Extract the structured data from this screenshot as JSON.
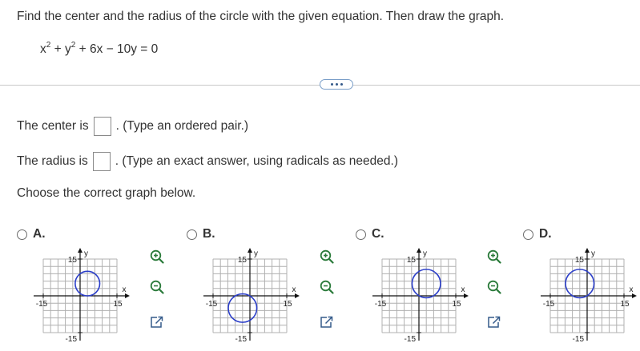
{
  "question": {
    "prompt": "Find the center and the radius of the circle with the given equation. Then draw the graph.",
    "equation": {
      "x_term": "x",
      "x_exp": "2",
      "plus_y": " + y",
      "y_exp": "2",
      "rest": " + 6x − 10y = 0"
    }
  },
  "answers": {
    "center_prefix": "The center is",
    "center_suffix": ". (Type an ordered pair.)",
    "center_value": "",
    "radius_prefix": "The radius is",
    "radius_suffix": ". (Type an exact answer, using radicals as needed.)",
    "radius_value": ""
  },
  "choose_text": "Choose the correct graph below.",
  "options": [
    {
      "label": "A.",
      "chart_data": {
        "type": "scatter",
        "shape": "circle",
        "xlim": [
          -15,
          15
        ],
        "ylim": [
          -15,
          15
        ],
        "xlabel": "x",
        "ylabel": "y",
        "x_tick_labels": [
          "-15",
          "15"
        ],
        "y_tick_labels": [
          "15",
          "-15"
        ],
        "center": [
          3,
          5
        ],
        "radius": 5,
        "grid": true,
        "circle_color": "#2b3ec9"
      }
    },
    {
      "label": "B.",
      "chart_data": {
        "type": "scatter",
        "shape": "circle",
        "xlim": [
          -15,
          15
        ],
        "ylim": [
          -15,
          15
        ],
        "xlabel": "x",
        "ylabel": "y",
        "x_tick_labels": [
          "-15",
          "15"
        ],
        "y_tick_labels": [
          "15",
          "-15"
        ],
        "center": [
          -3,
          -5
        ],
        "radius": 5.8,
        "grid": true,
        "circle_color": "#2b3ec9"
      }
    },
    {
      "label": "C.",
      "chart_data": {
        "type": "scatter",
        "shape": "circle",
        "xlim": [
          -15,
          15
        ],
        "ylim": [
          -15,
          15
        ],
        "xlabel": "x",
        "ylabel": "y",
        "x_tick_labels": [
          "-15",
          "15"
        ],
        "y_tick_labels": [
          "15",
          "-15"
        ],
        "center": [
          3,
          5
        ],
        "radius": 5.8,
        "grid": true,
        "circle_color": "#2b3ec9"
      }
    },
    {
      "label": "D.",
      "chart_data": {
        "type": "scatter",
        "shape": "circle",
        "xlim": [
          -15,
          15
        ],
        "ylim": [
          -15,
          15
        ],
        "xlabel": "x",
        "ylabel": "y",
        "x_tick_labels": [
          "-15",
          "15"
        ],
        "y_tick_labels": [
          "15",
          "-15"
        ],
        "center": [
          -3,
          5
        ],
        "radius": 5.8,
        "grid": true,
        "circle_color": "#2b3ec9"
      }
    }
  ],
  "tool_icons": [
    "zoom-in-icon",
    "zoom-out-icon",
    "expand-icon"
  ],
  "colors": {
    "text": "#333333",
    "accent": "#345a8a",
    "icon_green": "#2a7a3a",
    "circle": "#2b3ec9",
    "grid": "#b0b0b0"
  }
}
